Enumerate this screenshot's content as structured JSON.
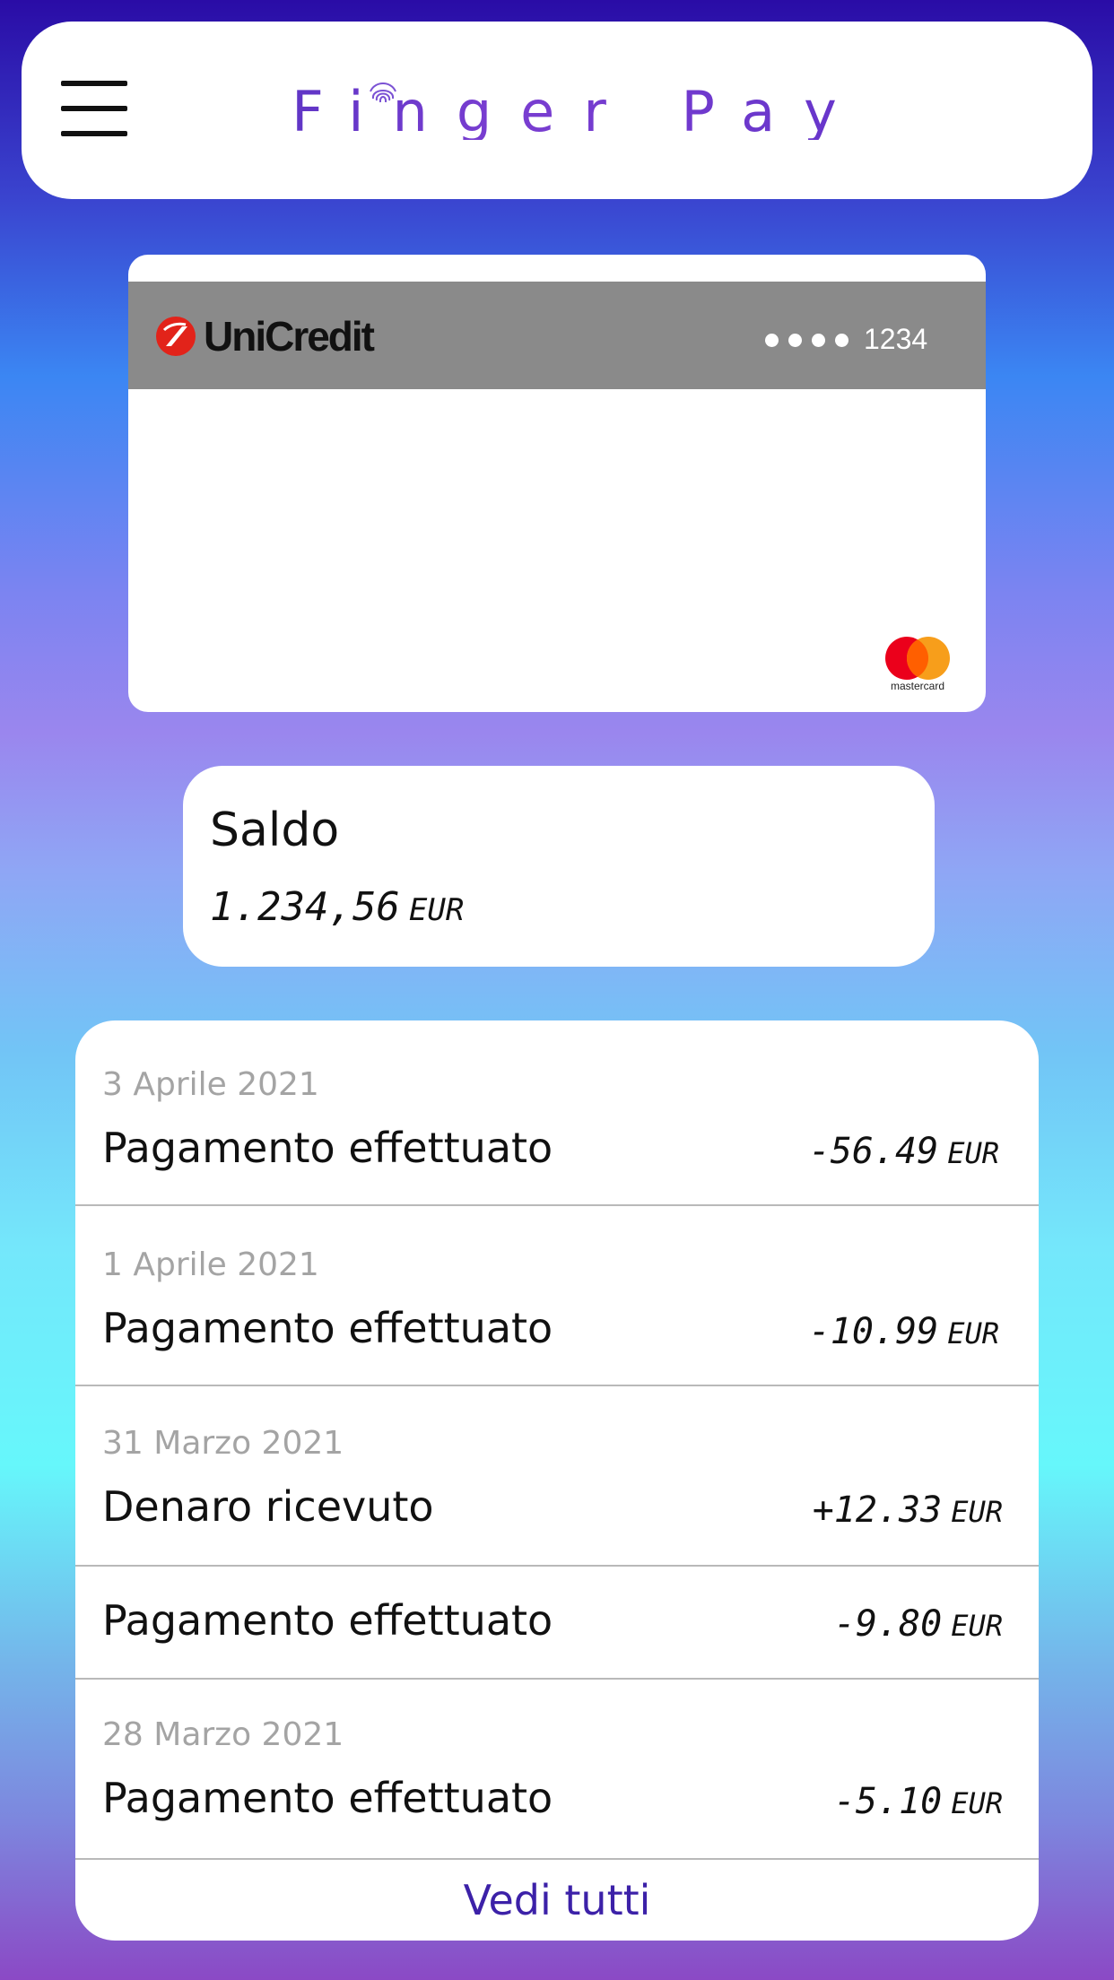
{
  "header": {
    "app_title": "Finger Pay"
  },
  "card": {
    "bank_name": "UniCredit",
    "last4": "1234",
    "network": "mastercard"
  },
  "balance": {
    "title": "Saldo",
    "amount": "1.234,56",
    "currency": "EUR"
  },
  "transactions": [
    {
      "date": "3 Aprile 2021",
      "description": "Pagamento effettuato",
      "amount": "-56.49",
      "currency": "EUR"
    },
    {
      "date": "1 Aprile 2021",
      "description": "Pagamento effettuato",
      "amount": "-10.99",
      "currency": "EUR"
    },
    {
      "date": "31 Marzo 2021",
      "description": "Denaro ricevuto",
      "amount": "+12.33",
      "currency": "EUR"
    },
    {
      "date": "",
      "description": "Pagamento effettuato",
      "amount": "-9.80",
      "currency": "EUR"
    },
    {
      "date": "28 Marzo 2021",
      "description": "Pagamento effettuato",
      "amount": "-5.10",
      "currency": "EUR"
    }
  ],
  "see_all_label": "Vedi tutti",
  "icons": {
    "menu": "hamburger-menu-icon",
    "fingerprint": "fingerprint-icon",
    "bank_logo": "unicredit-logo-icon",
    "card_network": "mastercard-icon"
  },
  "colors": {
    "accent": "#3c21a8",
    "card_band": "#8a8a8a",
    "muted_text": "#a4a4a4"
  }
}
